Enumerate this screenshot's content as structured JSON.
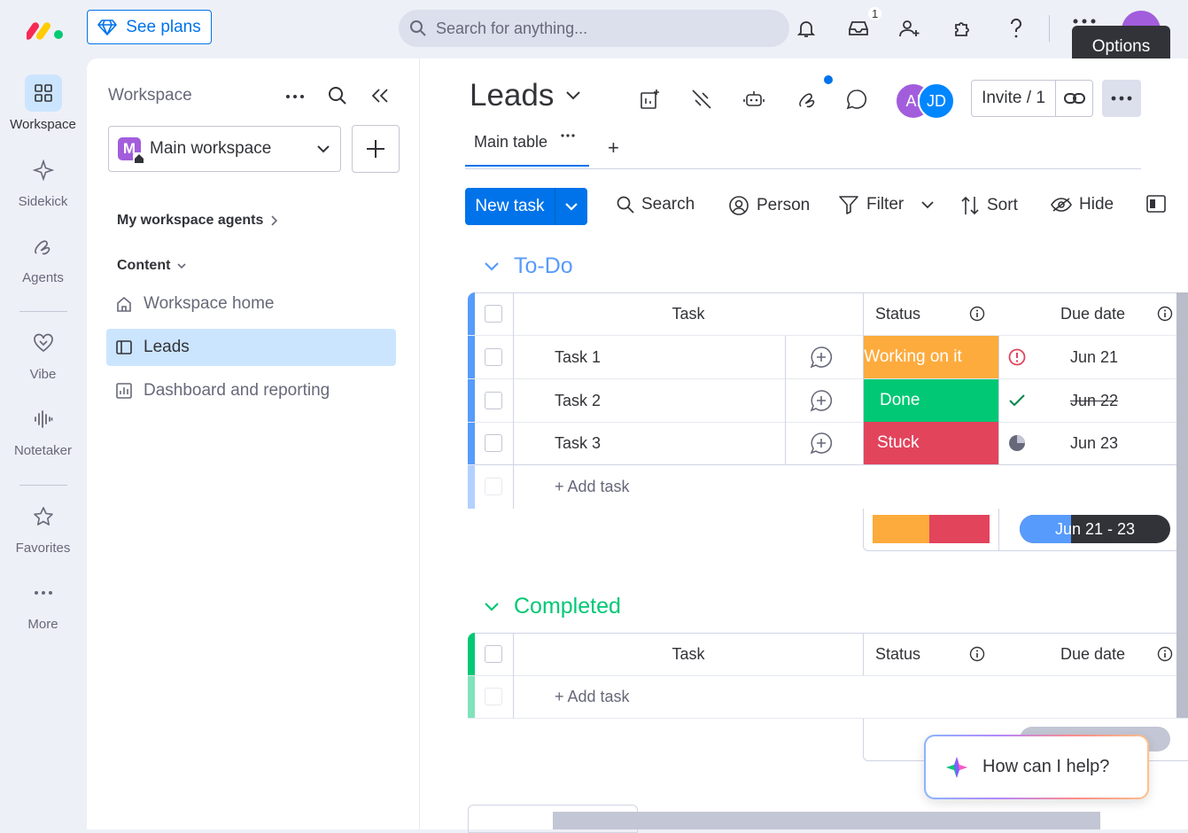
{
  "topbar": {
    "see_plans": "See plans",
    "search_placeholder": "Search for anything...",
    "inbox_badge": "1",
    "tooltip": "Options"
  },
  "rail": {
    "items": [
      {
        "label": "Workspace",
        "icon": "grid-icon"
      },
      {
        "label": "Sidekick",
        "icon": "sparkle-icon"
      },
      {
        "label": "Agents",
        "icon": "agents-icon"
      },
      {
        "label": "Vibe",
        "icon": "heart-icon"
      },
      {
        "label": "Notetaker",
        "icon": "audio-wave-icon"
      },
      {
        "label": "Favorites",
        "icon": "star-icon"
      },
      {
        "label": "More",
        "icon": "more-dots-icon"
      }
    ]
  },
  "workspace_panel": {
    "title": "Workspace",
    "selected_workspace": "Main workspace",
    "workspace_initial": "M",
    "agents_label": "My workspace agents",
    "content_label": "Content",
    "nav": [
      {
        "label": "Workspace home"
      },
      {
        "label": "Leads"
      },
      {
        "label": "Dashboard and reporting"
      }
    ]
  },
  "board": {
    "title": "Leads",
    "avatars": [
      {
        "initials": "AI",
        "color": "#a25ddc"
      },
      {
        "initials": "JD",
        "color": "#0086ff"
      }
    ],
    "invite_label": "Invite / 1",
    "tab_main": "Main table",
    "tab_add": "+",
    "toolbar": {
      "new_task": "New task",
      "search": "Search",
      "person": "Person",
      "filter": "Filter",
      "sort": "Sort",
      "hide": "Hide"
    }
  },
  "groups": [
    {
      "title": "To-Do",
      "color": "#579bfc",
      "columns": {
        "task": "Task",
        "status": "Status",
        "due": "Due date"
      },
      "rows": [
        {
          "task": "Task 1",
          "status": "Working on it",
          "status_color": "#fdab3d",
          "due": "Jun 21",
          "due_icon": "alert-icon"
        },
        {
          "task": "Task 2",
          "status": "Done",
          "status_color": "#00c875",
          "due": "Jun 22",
          "due_icon": "check-icon"
        },
        {
          "task": "Task 3",
          "status": "Stuck",
          "status_color": "#e2445c",
          "due": "Jun 23",
          "due_icon": "clock-icon"
        }
      ],
      "add_task": "+ Add task",
      "due_range": "Jun 21 - 23"
    },
    {
      "title": "Completed",
      "color": "#00c875",
      "columns": {
        "task": "Task",
        "status": "Status",
        "due": "Due date"
      },
      "add_task": "+ Add task"
    }
  ],
  "assistant": {
    "prompt": "How can I help?"
  }
}
